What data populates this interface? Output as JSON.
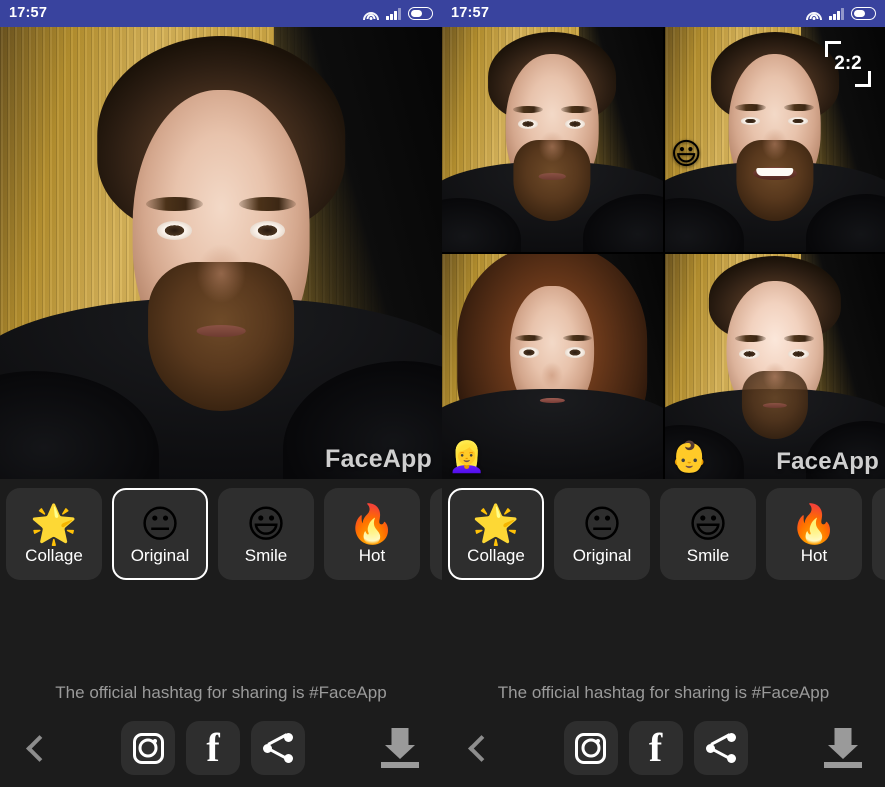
{
  "app": {
    "name": "FaceApp",
    "watermark": "FaceApp"
  },
  "status_bar": {
    "time": "17:57",
    "background_color": "#39439e",
    "icons": [
      "wifi-icon",
      "cellular-signal-icon",
      "battery-icon"
    ]
  },
  "panels": [
    {
      "id": "left",
      "view_mode": "single",
      "selected_filter": "Original",
      "photo": {
        "watermark": "FaceApp",
        "description": "bearded man selfie, neutral expression, wooden door background"
      },
      "ratio_indicator": null,
      "filters": [
        {
          "label": "Collage",
          "icon": "sparkle-emoji",
          "glyph": "🌟",
          "selected": false
        },
        {
          "label": "Original",
          "icon": "neutral-face-emoji",
          "glyph": "😐",
          "selected": true
        },
        {
          "label": "Smile",
          "icon": "grinning-face-emoji",
          "glyph": "😃",
          "selected": false
        },
        {
          "label": "Hot",
          "icon": "fire-emoji",
          "glyph": "🔥",
          "selected": false
        }
      ],
      "hashtag_note": "The official hashtag for sharing is #FaceApp",
      "actions": {
        "back": "back-chevron",
        "instagram": "Instagram",
        "facebook": "Facebook",
        "share": "Share",
        "download": "Download"
      }
    },
    {
      "id": "right",
      "view_mode": "collage",
      "selected_filter": "Collage",
      "ratio_indicator": "2:2",
      "collage_cells": [
        {
          "position": "top-left",
          "filter": "Original",
          "badge": null,
          "badge_glyph": null,
          "watermark": null
        },
        {
          "position": "top-right",
          "filter": "Smile",
          "badge": "grinning-face-emoji",
          "badge_glyph": "😃",
          "watermark": null
        },
        {
          "position": "bottom-left",
          "filter": "Female",
          "badge": "woman-emoji",
          "badge_glyph": "👱‍♀️",
          "watermark": null
        },
        {
          "position": "bottom-right",
          "filter": "Young",
          "badge": "baby-emoji",
          "badge_glyph": "👶",
          "watermark": "FaceApp"
        }
      ],
      "filters": [
        {
          "label": "Collage",
          "icon": "sparkle-emoji",
          "glyph": "🌟",
          "selected": true
        },
        {
          "label": "Original",
          "icon": "neutral-face-emoji",
          "glyph": "😐",
          "selected": false
        },
        {
          "label": "Smile",
          "icon": "grinning-face-emoji",
          "glyph": "😃",
          "selected": false
        },
        {
          "label": "Hot",
          "icon": "fire-emoji",
          "glyph": "🔥",
          "selected": false
        }
      ],
      "hashtag_note": "The official hashtag for sharing is #FaceApp",
      "actions": {
        "back": "back-chevron",
        "instagram": "Instagram",
        "facebook": "Facebook",
        "share": "Share",
        "download": "Download"
      }
    }
  ],
  "colors": {
    "background": "#1c1c1c",
    "tile": "#2e2e2e",
    "status_blue": "#39439e",
    "selected_border": "#ffffff",
    "muted_text": "#9a9a9a",
    "watermark_text": "#cfcfcf"
  }
}
